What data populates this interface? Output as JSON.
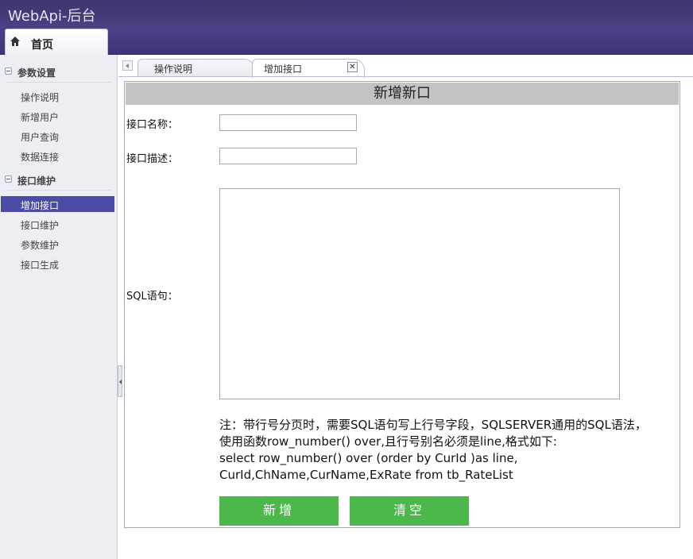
{
  "header": {
    "app_title": "WebApi-后台"
  },
  "nav": {
    "home_tab_label": "首页"
  },
  "sidebar": {
    "groups": [
      {
        "label": "参数设置",
        "items": [
          "操作说明",
          "新增用户",
          "用户查询",
          "数据连接"
        ]
      },
      {
        "label": "接口维护",
        "items": [
          "增加接口",
          "接口维护",
          "参数维护",
          "接口生成"
        ]
      }
    ],
    "active_item": "增加接口"
  },
  "tabs": [
    {
      "label": "操作说明",
      "active": false
    },
    {
      "label": "增加接口",
      "active": true
    }
  ],
  "form": {
    "title": "新增新口",
    "name_label": "接口名称：",
    "name_value": "",
    "desc_label": "接口描述：",
    "desc_value": "",
    "sql_label": "SQL语句：",
    "sql_value": "",
    "note_lines": [
      "注：带行号分页时，需要SQL语句写上行号字段，SQLSERVER通用的SQL语法，",
      "使用函数row_number() over,且行号别名必须是line,格式如下:",
      "select row_number() over (order by CurId )as line,",
      "CurId,ChName,CurName,ExRate from tb_RateList"
    ],
    "add_button": "新增",
    "clear_button": "清空"
  },
  "colors": {
    "header": "#4a3f80",
    "active_item": "#4b4aa4",
    "button": "#4cb84c",
    "panel_title": "#c3c3c3"
  },
  "icons": {
    "home": "home-icon",
    "tab_close": "close-icon"
  }
}
